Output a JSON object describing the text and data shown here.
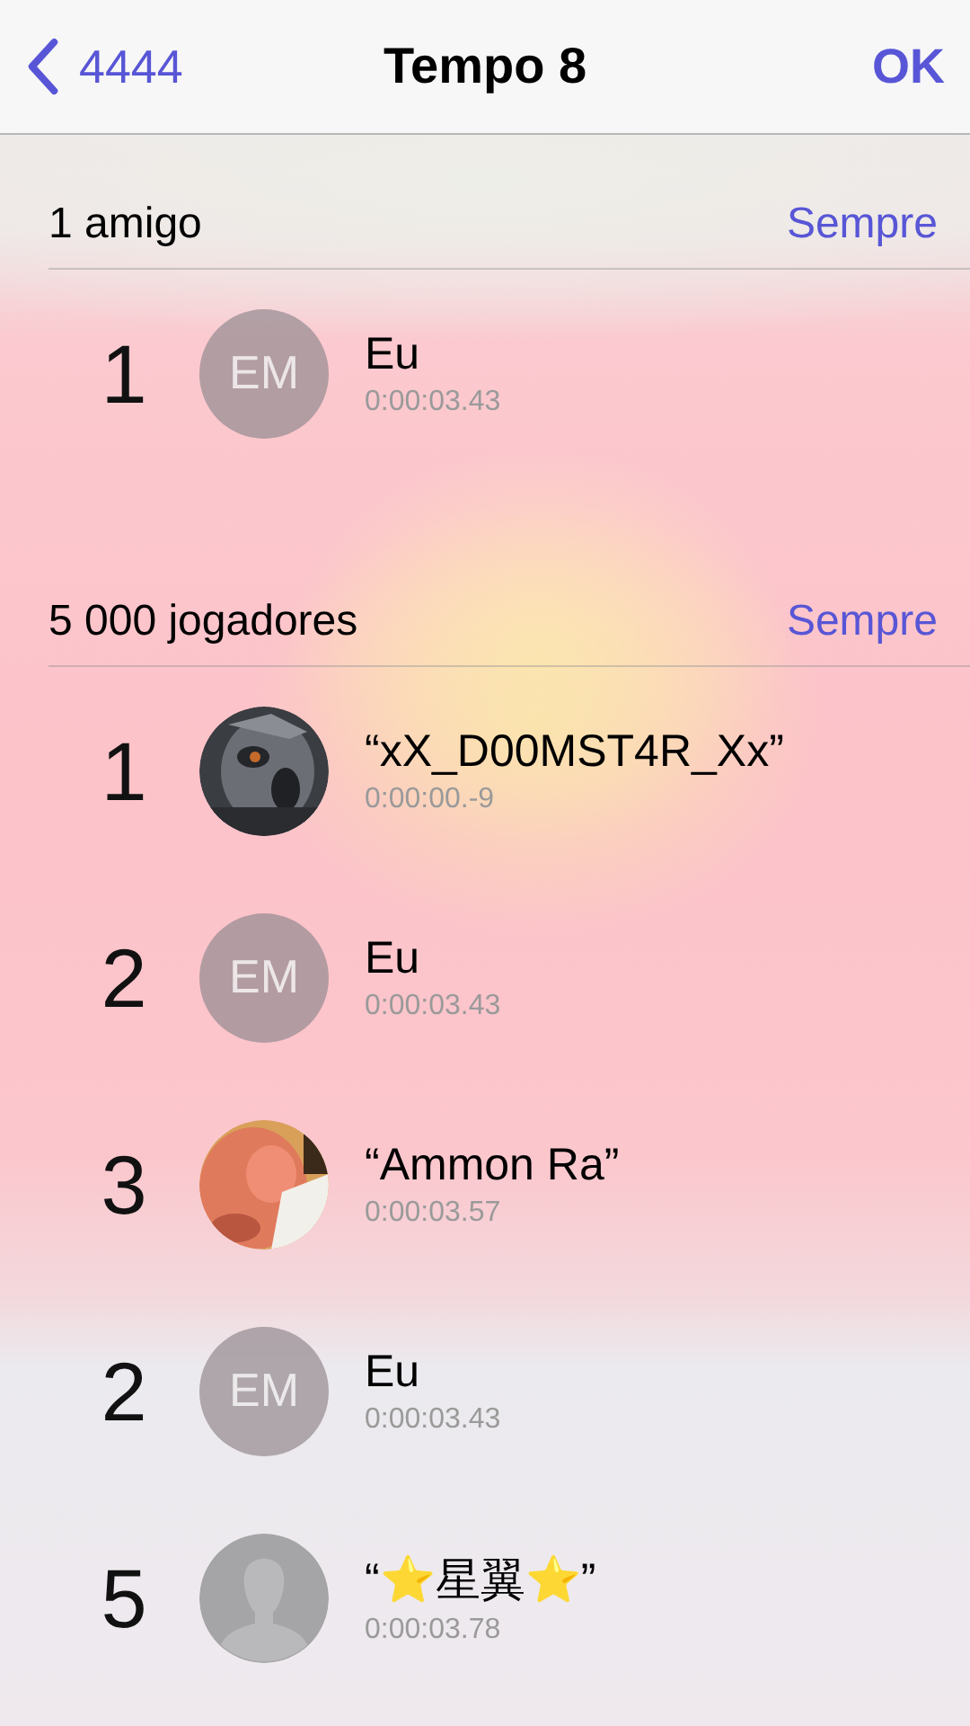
{
  "nav_bar": {
    "back_label": "4444",
    "title": "Tempo 8",
    "action": "OK"
  },
  "sections": [
    {
      "header": "1 amigo",
      "filter": "Sempre",
      "rows": [
        {
          "rank": "1",
          "avatar": {
            "kind": "initials",
            "initials": "EM"
          },
          "name": "Eu",
          "time": "0:00:03.43"
        }
      ]
    },
    {
      "header": "5 000 jogadores",
      "filter": "Sempre",
      "rows": [
        {
          "rank": "1",
          "name": "“xX_D00MST4R_Xx”",
          "time": "0:00:00.-9"
        },
        {
          "rank": "2",
          "avatar": {
            "kind": "initials",
            "initials": "EM"
          },
          "name": "Eu",
          "time": "0:00:03.43"
        },
        {
          "rank": "3",
          "name": "“Ammon Ra”",
          "time": "0:00:03.57"
        },
        {
          "rank": "2",
          "avatar": {
            "kind": "initials",
            "initials": "EM"
          },
          "name": "Eu",
          "time": "0:00:03.43"
        },
        {
          "rank": "5",
          "avatar": {
            "kind": "silhouette"
          },
          "name": "“⭐星翼⭐”",
          "time": "0:00:03.78"
        }
      ]
    }
  ]
}
